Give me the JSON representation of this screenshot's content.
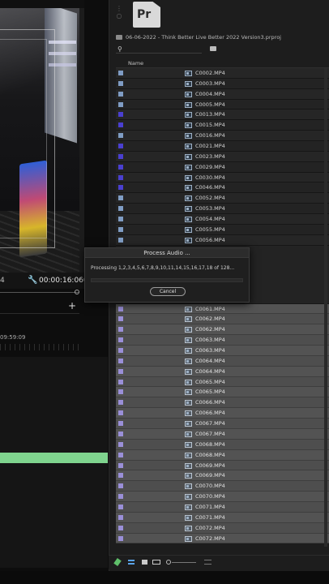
{
  "project": {
    "app_icon_label": "Pr",
    "file_path": "06-06-2022 - Think Better Live Better 2022 Version3.prproj",
    "column_name": "Name",
    "clips": [
      {
        "name": "C0002.MP4",
        "color": "#7f9cc4"
      },
      {
        "name": "C0003.MP4",
        "color": "#7f9cc4"
      },
      {
        "name": "C0004.MP4",
        "color": "#7f9cc4"
      },
      {
        "name": "C0005.MP4",
        "color": "#7f9cc4"
      },
      {
        "name": "C0013.MP4",
        "color": "#4a3fd0"
      },
      {
        "name": "C0015.MP4",
        "color": "#4a3fd0"
      },
      {
        "name": "C0016.MP4",
        "color": "#7f9cc4"
      },
      {
        "name": "C0021.MP4",
        "color": "#4a3fd0"
      },
      {
        "name": "C0023.MP4",
        "color": "#4a3fd0"
      },
      {
        "name": "C0029.MP4",
        "color": "#4a3fd0"
      },
      {
        "name": "C0030.MP4",
        "color": "#4a3fd0"
      },
      {
        "name": "C0046.MP4",
        "color": "#4a3fd0"
      },
      {
        "name": "C0052.MP4",
        "color": "#7f9cc4"
      },
      {
        "name": "C0053.MP4",
        "color": "#7f9cc4"
      },
      {
        "name": "C0054.MP4",
        "color": "#7f9cc4"
      },
      {
        "name": "C0055.MP4",
        "color": "#7f9cc4"
      },
      {
        "name": "C0056.MP4",
        "color": "#7f9cc4"
      }
    ],
    "clips_highlighted": [
      {
        "name": "C0061.MP4",
        "color": "#9a8fd8"
      },
      {
        "name": "C0062.MP4",
        "color": "#9a8fd8"
      },
      {
        "name": "C0062.MP4",
        "color": "#9a8fd8"
      },
      {
        "name": "C0063.MP4",
        "color": "#9a8fd8"
      },
      {
        "name": "C0063.MP4",
        "color": "#9a8fd8"
      },
      {
        "name": "C0064.MP4",
        "color": "#9a8fd8"
      },
      {
        "name": "C0064.MP4",
        "color": "#9a8fd8"
      },
      {
        "name": "C0065.MP4",
        "color": "#9a8fd8"
      },
      {
        "name": "C0065.MP4",
        "color": "#9a8fd8"
      },
      {
        "name": "C0066.MP4",
        "color": "#9a8fd8"
      },
      {
        "name": "C0066.MP4",
        "color": "#9a8fd8"
      },
      {
        "name": "C0067.MP4",
        "color": "#9a8fd8"
      },
      {
        "name": "C0067.MP4",
        "color": "#9a8fd8"
      },
      {
        "name": "C0068.MP4",
        "color": "#9a8fd8"
      },
      {
        "name": "C0068.MP4",
        "color": "#9a8fd8"
      },
      {
        "name": "C0069.MP4",
        "color": "#9a8fd8"
      },
      {
        "name": "C0069.MP4",
        "color": "#9a8fd8"
      },
      {
        "name": "C0070.MP4",
        "color": "#9a8fd8"
      },
      {
        "name": "C0070.MP4",
        "color": "#9a8fd8"
      },
      {
        "name": "C0071.MP4",
        "color": "#9a8fd8"
      },
      {
        "name": "C0071.MP4",
        "color": "#9a8fd8"
      },
      {
        "name": "C0072.MP4",
        "color": "#9a8fd8"
      },
      {
        "name": "C0072.MP4",
        "color": "#9a8fd8"
      }
    ]
  },
  "monitor": {
    "timecode_left": "4",
    "timecode_right": "00:00:16:060",
    "add_label": "+",
    "sequence_time": "09:59:09"
  },
  "dialog": {
    "title": "Process Audio ...",
    "message": "Processing 1,2,3,4,5,6,7,8,9,10,11,14,15,16,17,18 of 128...",
    "progress": 0.0,
    "cancel_label": "Cancel"
  },
  "colors": {
    "audio_track": "#7fd48e",
    "label_blue": "#4a3fd0",
    "label_steel": "#7f9cc4",
    "label_lavender": "#9a8fd8"
  }
}
